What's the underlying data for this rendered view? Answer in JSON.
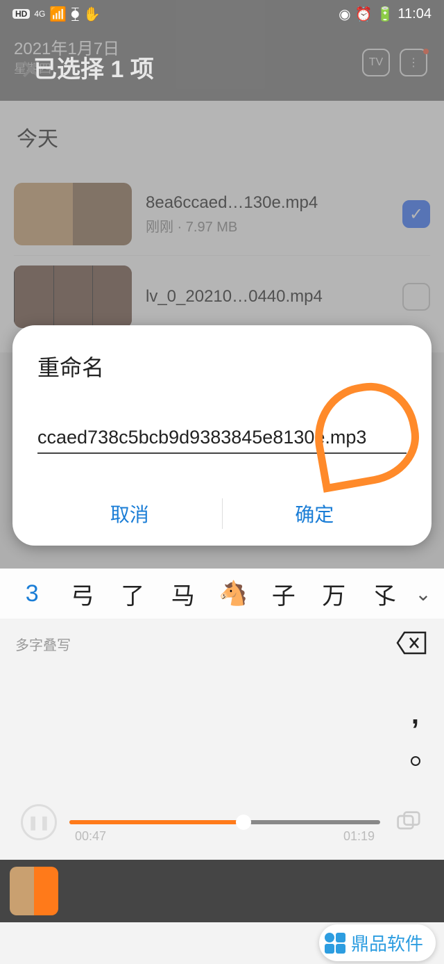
{
  "status": {
    "hd": "HD",
    "net": "4G",
    "time": "11:04"
  },
  "header": {
    "date": "2021年1月7日",
    "weekday": "星期四",
    "selection": "已选择 1 项",
    "tv": "TV"
  },
  "list": {
    "section": "今天",
    "files": [
      {
        "name": "8ea6ccaed…130e.mp4",
        "meta": "刚刚 · 7.97 MB",
        "checked": true
      },
      {
        "name": "lv_0_20210…0440.mp4",
        "meta": "",
        "checked": false
      }
    ]
  },
  "dialog": {
    "title": "重命名",
    "value": "ccaed738c5bcb9d9383845e8130e.mp3",
    "cancel": "取消",
    "confirm": "确定"
  },
  "candidates": {
    "first": "3",
    "rest": [
      "弓",
      "了",
      "马",
      "🐴",
      "子",
      "万",
      "孓"
    ],
    "hint": "多字叠写"
  },
  "player": {
    "current": "00:47",
    "total": "01:19"
  },
  "watermark": "鼎品软件"
}
